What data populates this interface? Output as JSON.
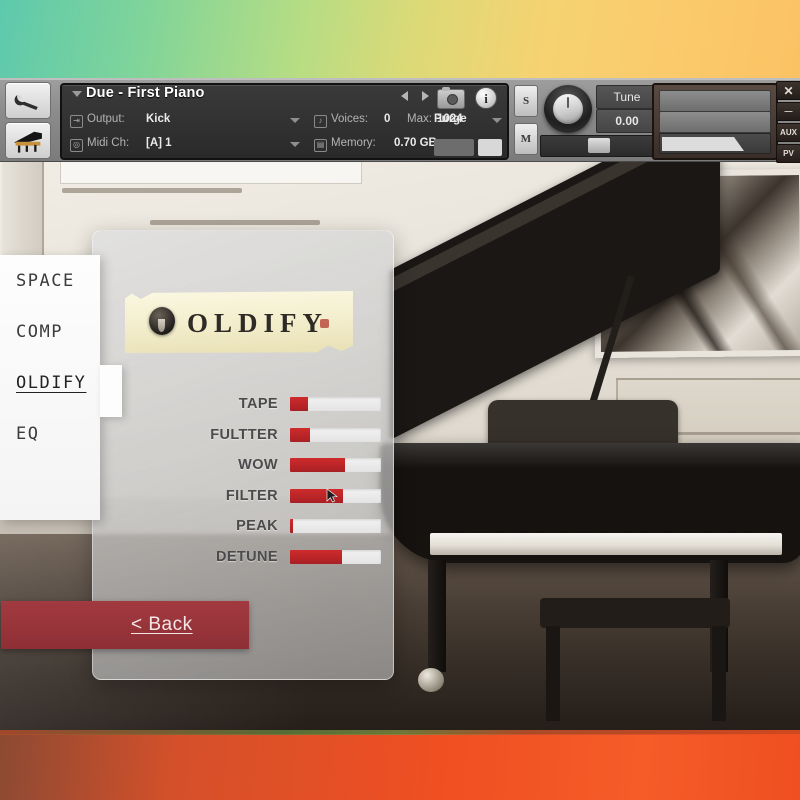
{
  "window": {
    "right_buttons": [
      {
        "name": "close",
        "label": "✕"
      },
      {
        "name": "minimize",
        "label": "—"
      },
      {
        "name": "aux",
        "label": "AUX"
      },
      {
        "name": "pv",
        "label": "PV"
      }
    ]
  },
  "kontakt_header": {
    "tools": [
      {
        "name": "wrench",
        "label": "wrench-icon"
      },
      {
        "name": "instrument",
        "label": "piano-icon"
      }
    ],
    "instrument_title": "Due - First Piano",
    "nav": {
      "prev": "◀",
      "next": "▶",
      "snapshot": "camera-icon",
      "info": "i"
    },
    "output": {
      "label": "Output:",
      "value": "Kick"
    },
    "midi_ch": {
      "label": "Midi Ch:",
      "value": "[A]  1"
    },
    "voices": {
      "label": "Voices:",
      "value": "0"
    },
    "max": {
      "label": "Max:",
      "value": "1024"
    },
    "memory": {
      "label": "Memory:",
      "value": "0.70 GB"
    },
    "purge": {
      "label": "Purge"
    },
    "solo_button": "S",
    "mute_button": "M",
    "tune": {
      "label": "Tune",
      "value": "0.00"
    }
  },
  "plugin": {
    "logo_text": "OLDIFY",
    "back_button": "< Back",
    "menu": [
      {
        "id": "space",
        "label": "SPACE",
        "active": false
      },
      {
        "id": "comp",
        "label": "COMP",
        "active": false
      },
      {
        "id": "oldify",
        "label": "OLDIFY",
        "active": true
      },
      {
        "id": "eq",
        "label": "EQ",
        "active": false
      }
    ],
    "sliders": [
      {
        "label": "TAPE",
        "value": 20
      },
      {
        "label": "FULTTER",
        "value": 22
      },
      {
        "label": "WOW",
        "value": 60
      },
      {
        "label": "FILTER",
        "value": 58
      },
      {
        "label": "PEAK",
        "value": 3
      },
      {
        "label": "DETUNE",
        "value": 57
      }
    ]
  },
  "colors": {
    "slider_fill": "#c02a2a",
    "back_button": "#9a3339",
    "band_top_start": "#5ec9ad",
    "band_bottom": "#f04f22"
  }
}
